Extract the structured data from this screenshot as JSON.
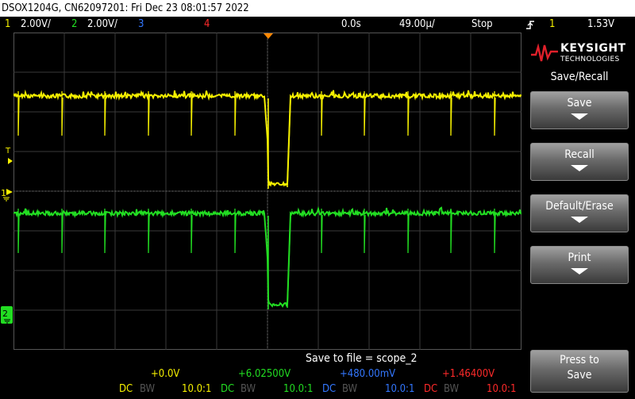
{
  "title_bar": "DSOX1204G, CN62097201: Fri Dec 23 08:01:57 2022",
  "status": {
    "ch1_num": "1",
    "ch1_scale": "2.00V/",
    "ch2_num": "2",
    "ch2_scale": "2.00V/",
    "ch3_num": "3",
    "ch4_num": "4",
    "time_delay": "0.0s",
    "time_scale": "49.00µ/",
    "run_state": "Stop",
    "trig_icon": "trigger-edge-icon",
    "trig_source": "1",
    "trig_level": "1.53V"
  },
  "brand": {
    "name": "KEYSIGHT",
    "sub": "TECHNOLOGIES",
    "logo_icon": "keysight-wave-logo"
  },
  "menu": {
    "title": "Save/Recall",
    "buttons": [
      {
        "label": "Save"
      },
      {
        "label": "Recall"
      },
      {
        "label": "Default/Erase"
      },
      {
        "label": "Print"
      }
    ],
    "press_to_save_1": "Press to",
    "press_to_save_2": "Save"
  },
  "markers": {
    "trigger_level": "T",
    "ch1": "1",
    "ch2": "2"
  },
  "message": "Save to file =  scope_2",
  "channels": [
    {
      "offset": "+0.0V",
      "coupling": "DC",
      "bw": "BW",
      "probe": "10.0:1",
      "color": "#f5f000"
    },
    {
      "offset": "+6.02500V",
      "coupling": "DC",
      "bw": "BW",
      "probe": "10.0:1",
      "color": "#22dd22"
    },
    {
      "offset": "+480.00mV",
      "coupling": "DC",
      "bw": "BW",
      "probe": "10.0:1",
      "color": "#3377ff"
    },
    {
      "offset": "+1.46400V",
      "coupling": "DC",
      "bw": "BW",
      "probe": "10.0:1",
      "color": "#ff2a2a"
    }
  ],
  "colors": {
    "ch1": "#f5f000",
    "ch2": "#22dd22",
    "ch3": "#3377ff",
    "ch4": "#ff2a2a",
    "trigger": "#ff8800"
  }
}
